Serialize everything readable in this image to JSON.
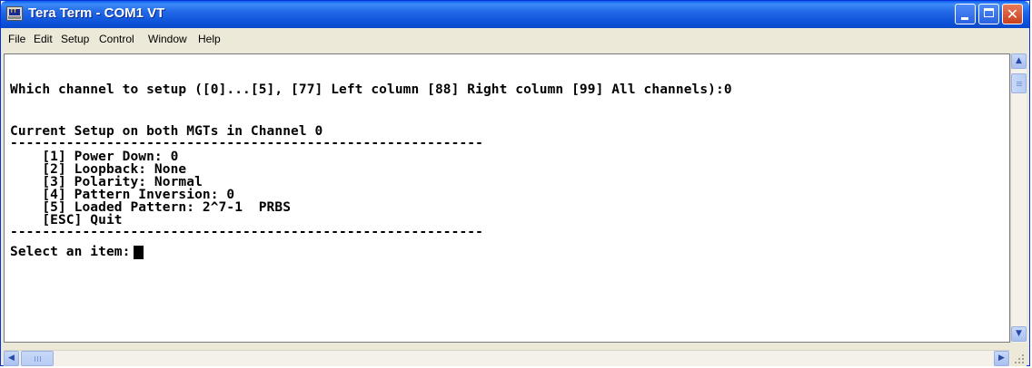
{
  "window": {
    "title": "Tera Term - COM1 VT",
    "titlebar_color": "#2268e8"
  },
  "menu": {
    "items": [
      "File",
      "Edit",
      "Setup",
      "Control",
      "Window",
      "Help"
    ]
  },
  "terminal": {
    "lines": [
      "Which channel to setup ([0]...[5], [77] Left column [88] Right column [99] All channels):0",
      "",
      "Current Setup on both MGTs in Channel 0",
      "-----------------------------------------------------------",
      "    [1] Power Down: 0",
      "    [2] Loopback: None",
      "    [3] Polarity: Normal",
      "    [4] Pattern Inversion: 0",
      "    [5] Loaded Pattern: 2^7-1  PRBS",
      "    [ESC] Quit",
      "-----------------------------------------------------------",
      "Select an item:"
    ]
  },
  "icons": {
    "app": "teraterm-icon",
    "minimize": "minimize-icon",
    "maximize": "maximize-icon",
    "close": "close-icon",
    "scroll_up": "arrow-up-icon",
    "scroll_down": "arrow-down-icon",
    "scroll_left": "arrow-left-icon",
    "scroll_right": "arrow-right-icon",
    "close_glyph": "✕"
  }
}
